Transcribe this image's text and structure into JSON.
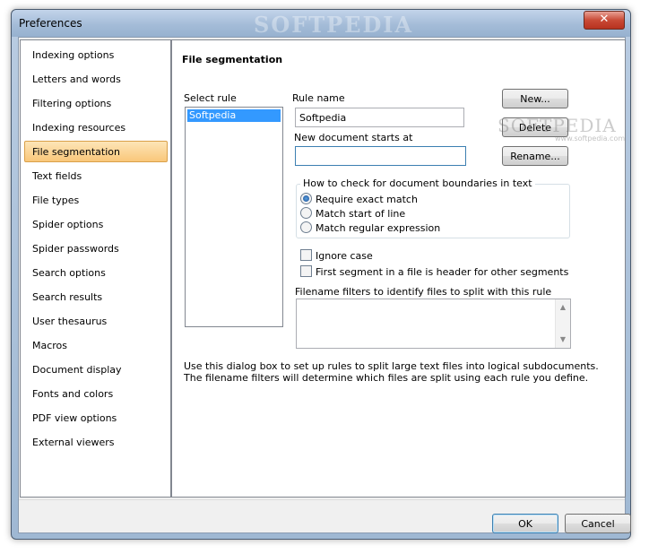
{
  "window": {
    "title": "Preferences",
    "title_watermark": "SOFTPEDIA",
    "close_glyph": "✕"
  },
  "nav": {
    "items": [
      {
        "label": "Indexing options"
      },
      {
        "label": "Letters and words"
      },
      {
        "label": "Filtering options"
      },
      {
        "label": "Indexing resources"
      },
      {
        "label": "File segmentation",
        "selected": true
      },
      {
        "label": "Text fields"
      },
      {
        "label": "File types"
      },
      {
        "label": "Spider options"
      },
      {
        "label": "Spider passwords"
      },
      {
        "label": "Search options"
      },
      {
        "label": "Search results"
      },
      {
        "label": "User thesaurus"
      },
      {
        "label": "Macros"
      },
      {
        "label": "Document display"
      },
      {
        "label": "Fonts and colors"
      },
      {
        "label": "PDF view options"
      },
      {
        "label": "External viewers"
      }
    ]
  },
  "panel": {
    "heading": "File segmentation",
    "select_rule_label": "Select rule",
    "rules": [
      "Softpedia"
    ],
    "rule_name_label": "Rule name",
    "rule_name_value": "Softpedia",
    "new_doc_label": "New document starts at",
    "new_doc_value": "",
    "buttons": {
      "new": "New...",
      "delete": "Delete",
      "rename": "Rename..."
    },
    "group_title": "How to check for document boundaries in text",
    "radios": [
      {
        "label": "Require exact match",
        "checked": true
      },
      {
        "label": "Match start of line",
        "checked": false
      },
      {
        "label": "Match regular expression",
        "checked": false
      }
    ],
    "checkboxes": [
      {
        "label": "Ignore case",
        "checked": false
      },
      {
        "label": "First segment in a file is header for other segments",
        "checked": false
      }
    ],
    "filters_label": "Filename filters to identify files to split with this rule",
    "filters_value": "",
    "help_text": "Use this dialog box to set up rules to split large text files into logical subdocuments.  The filename filters will determine which files are split using each rule you define.",
    "watermark": "SOFTPEDIA",
    "watermark_sub": "www.softpedia.com"
  },
  "footer": {
    "ok": "OK",
    "cancel": "Cancel"
  },
  "colors": {
    "selection": "#3399ff",
    "nav_selected": "#f9c77a",
    "close": "#c94a36"
  }
}
